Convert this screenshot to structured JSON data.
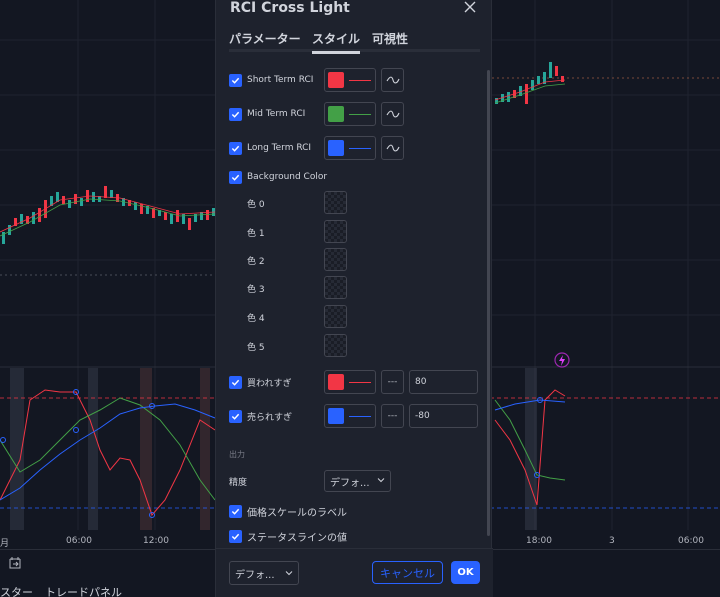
{
  "colors": {
    "accent": "#2962ff",
    "red": "#f23645",
    "green": "#43a047",
    "blue": "#2962ff",
    "background": "#131722",
    "dialog": "#1e222d"
  },
  "chart": {
    "time_labels": [
      "月",
      "06:00",
      "12:00",
      "18:00",
      "3",
      "06:00"
    ],
    "bottom_tabs": [
      "スター",
      "トレードパネル"
    ]
  },
  "dialog": {
    "title": "RCI Cross Light",
    "close_icon": "close-icon",
    "tabs": [
      {
        "label": "パラメーター",
        "active": false
      },
      {
        "label": "スタイル",
        "active": true
      },
      {
        "label": "可視性",
        "active": false
      }
    ],
    "plots": [
      {
        "label": "Short Term RCI",
        "checked": true,
        "color": "#f23645"
      },
      {
        "label": "Mid Term RCI",
        "checked": true,
        "color": "#43a047"
      },
      {
        "label": "Long Term RCI",
        "checked": true,
        "color": "#2962ff"
      }
    ],
    "background_color": {
      "label": "Background Color",
      "checked": true
    },
    "bg_colors": [
      "色 0",
      "色 1",
      "色 2",
      "色 3",
      "色 4",
      "色 5"
    ],
    "levels": [
      {
        "label": "買われすぎ",
        "checked": true,
        "color": "#f23645",
        "line_style": "---",
        "value": "80"
      },
      {
        "label": "売られすぎ",
        "checked": true,
        "color": "#2962ff",
        "line_style": "---",
        "value": "-80"
      }
    ],
    "output": {
      "section_title": "出力",
      "precision_label": "精度",
      "precision_value": "デフォ...",
      "price_scale_label": "価格スケールのラベル",
      "status_line_label": "ステータスラインの値"
    },
    "footer": {
      "template_value": "デフォ...",
      "cancel_label": "キャンセル",
      "ok_label": "OK"
    }
  }
}
